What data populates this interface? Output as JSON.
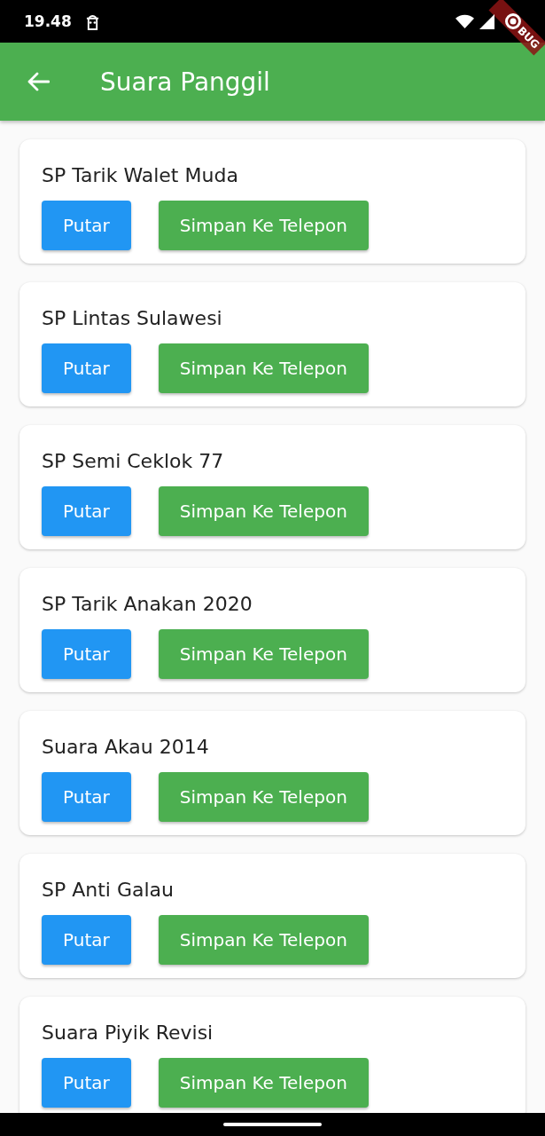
{
  "status_bar": {
    "time": "19.48"
  },
  "debug_banner": {
    "text": "BUG"
  },
  "app_bar": {
    "title": "Suara Panggil"
  },
  "sounds": [
    {
      "title": "SP Tarik Walet Muda",
      "buttons": [
        {
          "label": "Putar",
          "kind": "play"
        },
        {
          "label": "Simpan Ke Telepon",
          "kind": "save"
        }
      ]
    },
    {
      "title": "SP Lintas Sulawesi",
      "buttons": [
        {
          "label": "Putar",
          "kind": "play"
        },
        {
          "label": "Simpan Ke Telepon",
          "kind": "save"
        }
      ]
    },
    {
      "title": "SP Semi Ceklok 77",
      "buttons": [
        {
          "label": "Putar",
          "kind": "play"
        },
        {
          "label": "Simpan Ke Telepon",
          "kind": "save"
        }
      ]
    },
    {
      "title": "SP Tarik Anakan 2020",
      "buttons": [
        {
          "label": "Putar",
          "kind": "play"
        },
        {
          "label": "Simpan Ke Telepon",
          "kind": "save"
        }
      ]
    },
    {
      "title": "Suara Akau 2014",
      "buttons": [
        {
          "label": "Putar",
          "kind": "play"
        },
        {
          "label": "Simpan Ke Telepon",
          "kind": "save"
        }
      ]
    },
    {
      "title": "SP Anti Galau",
      "buttons": [
        {
          "label": "Putar",
          "kind": "play"
        },
        {
          "label": "Simpan Ke Telepon",
          "kind": "save"
        }
      ]
    },
    {
      "title": "Suara Piyik Revisi",
      "buttons": [
        {
          "label": "Putar",
          "kind": "play"
        },
        {
          "label": "Simpan Ke Telepon",
          "kind": "save"
        }
      ]
    }
  ]
}
